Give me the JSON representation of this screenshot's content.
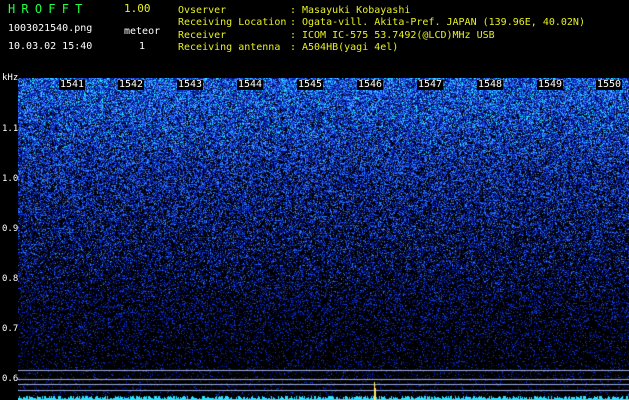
{
  "header": {
    "app_title": "HROFFT",
    "app_version": "1.00",
    "file_name": "1003021540.png",
    "datetime": "10.03.02 15:40",
    "meteor_label": "meteor",
    "meteor_count": "1"
  },
  "info": [
    {
      "key": "Ovserver",
      "sep": ":",
      "value": "Masayuki Kobayashi"
    },
    {
      "key": "Receiving Location",
      "sep": ":",
      "value": "Ogata-vill. Akita-Pref. JAPAN (139.96E, 40.02N)"
    },
    {
      "key": "Receiver",
      "sep": ":",
      "value": "ICOM IC-575 53.7492(@LCD)MHz USB"
    },
    {
      "key": "Receiving antenna",
      "sep": ":",
      "value": "A504HB(yagi 4el)"
    }
  ],
  "spectrogram": {
    "y_unit": "kHz",
    "y_ticks": [
      "1.1",
      "1.0",
      "0.9",
      "0.8",
      "0.7",
      "0.6"
    ],
    "x_ticks": [
      "1541",
      "1542",
      "1543",
      "1544",
      "1545",
      "1546",
      "1547",
      "1548",
      "1549",
      "1550"
    ],
    "colors": {
      "background": "#000000",
      "noise_deep": "#0a1a8a",
      "noise_bright": "#3a8cff",
      "noise_hot": "#30e0ff",
      "hline": "#9aa8d8",
      "meteor": "#ffe860"
    }
  }
}
